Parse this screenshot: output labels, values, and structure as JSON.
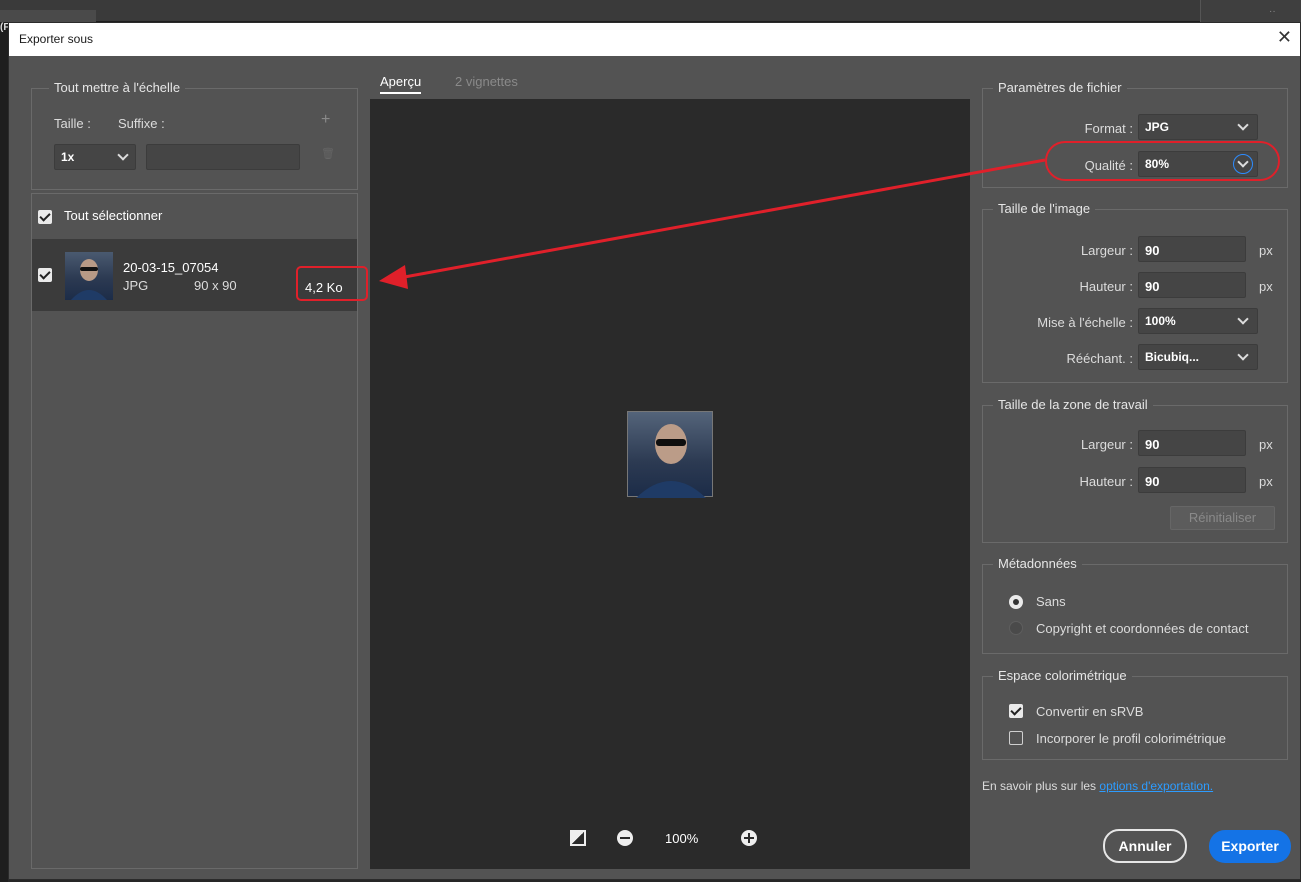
{
  "background_app": {
    "left_text": "(F"
  },
  "dialog": {
    "title": "Exporter sous",
    "close_glyph": "✕"
  },
  "scale_panel": {
    "legend": "Tout mettre à l'échelle",
    "size_label": "Taille :",
    "suffix_label": "Suffixe :",
    "size_value": "1x",
    "suffix_value": "",
    "add_glyph": "+",
    "delete_glyph": "🗑"
  },
  "assets": {
    "select_all": "Tout sélectionner",
    "items": [
      {
        "name": "20-03-15_07054",
        "format": "JPG",
        "dimensions": "90 x 90",
        "size": "4,2 Ko"
      }
    ]
  },
  "preview": {
    "tabs": [
      {
        "label": "Aperçu"
      },
      {
        "label": "2 vignettes"
      }
    ],
    "zoom": "100%"
  },
  "file_settings": {
    "legend": "Paramètres de fichier",
    "format_label": "Format :",
    "format_value": "JPG",
    "quality_label": "Qualité :",
    "quality_value": "80%"
  },
  "image_size": {
    "legend": "Taille de l'image",
    "width_label": "Largeur :",
    "width_value": "90",
    "height_label": "Hauteur :",
    "height_value": "90",
    "unit": "px",
    "scale_label": "Mise à l'échelle :",
    "scale_value": "100%",
    "resample_label": "Rééchant. :",
    "resample_value": "Bicubiq..."
  },
  "canvas_size": {
    "legend": "Taille de la zone de travail",
    "width_label": "Largeur :",
    "width_value": "90",
    "height_label": "Hauteur :",
    "height_value": "90",
    "unit": "px",
    "reset_label": "Réinitialiser"
  },
  "metadata": {
    "legend": "Métadonnées",
    "options": [
      {
        "label": "Sans"
      },
      {
        "label": "Copyright et coordonnées de contact"
      }
    ]
  },
  "color_space": {
    "legend": "Espace colorimétrique",
    "convert_label": "Convertir en sRVB",
    "embed_label": "Incorporer le profil colorimétrique"
  },
  "footer": {
    "learn_more_text": "En savoir plus sur les",
    "learn_more_link": "options d'exportation.",
    "cancel_label": "Annuler",
    "export_label": "Exporter"
  },
  "colors": {
    "annotation": "#e0202a",
    "accent": "#1473e6"
  }
}
